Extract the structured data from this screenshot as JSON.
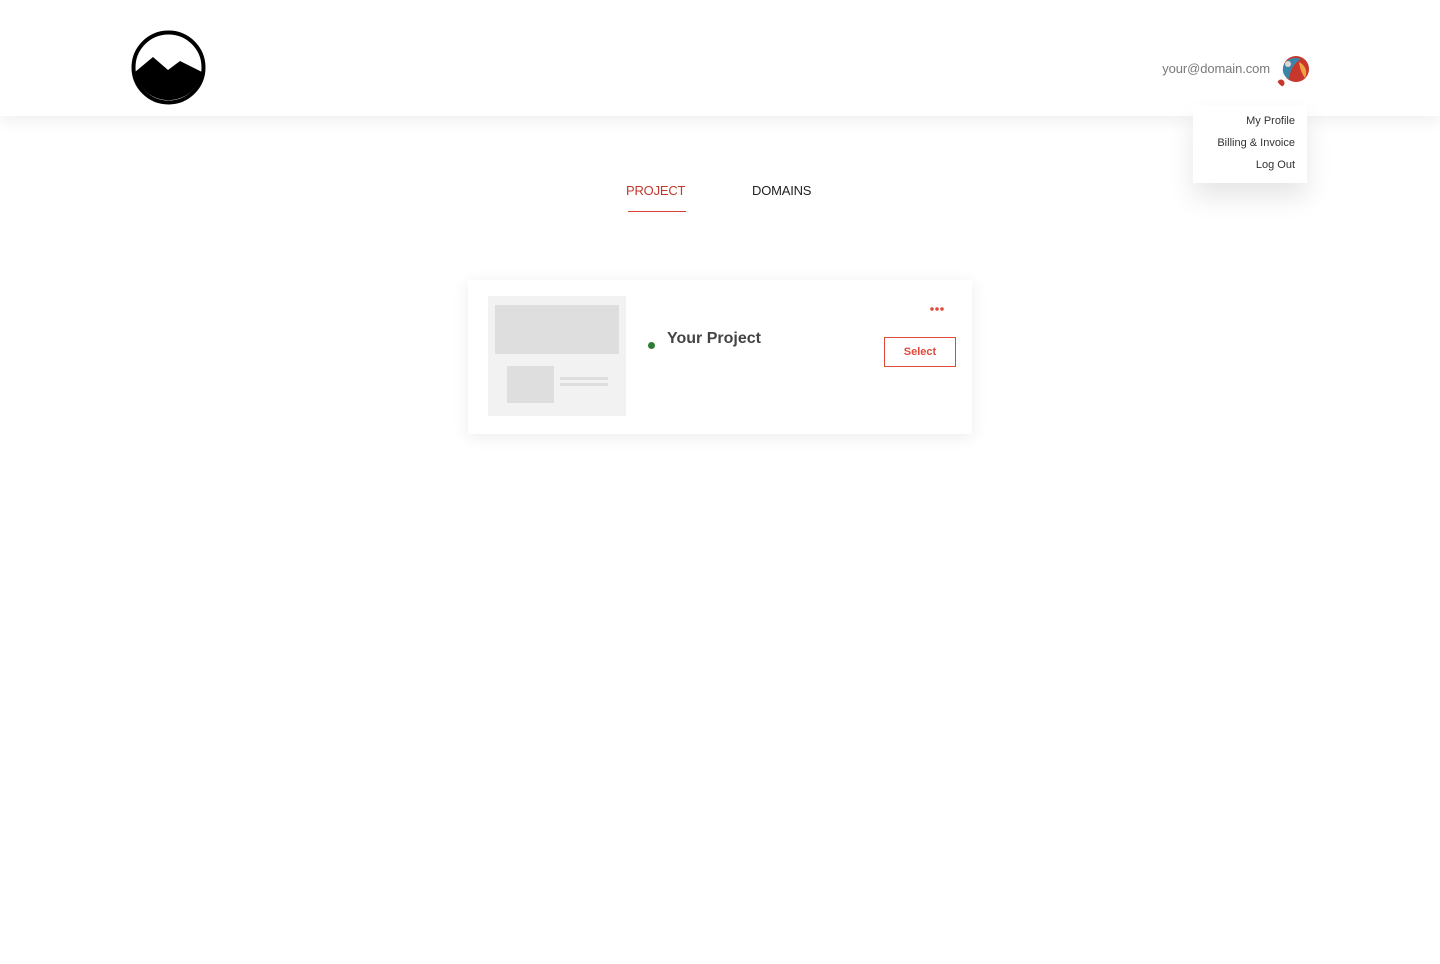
{
  "header": {
    "logo_icon": "mountain-circle-logo",
    "user_email": "your@domain.com",
    "avatar_icon": "user-avatar"
  },
  "user_menu": {
    "items": [
      {
        "label": "My Profile"
      },
      {
        "label": "Billing & Invoice"
      },
      {
        "label": "Log Out"
      }
    ]
  },
  "tabs": [
    {
      "label": "PROJECT",
      "active": true
    },
    {
      "label": "DOMAINS",
      "active": false
    }
  ],
  "project_card": {
    "name": "Your Project",
    "status_color": "#2e7d32",
    "select_label": "Select",
    "more_icon": "more-dots-icon"
  },
  "colors": {
    "accent": "#e04a3c",
    "active_tab": "#c0392b",
    "status": "#2e7d32"
  }
}
